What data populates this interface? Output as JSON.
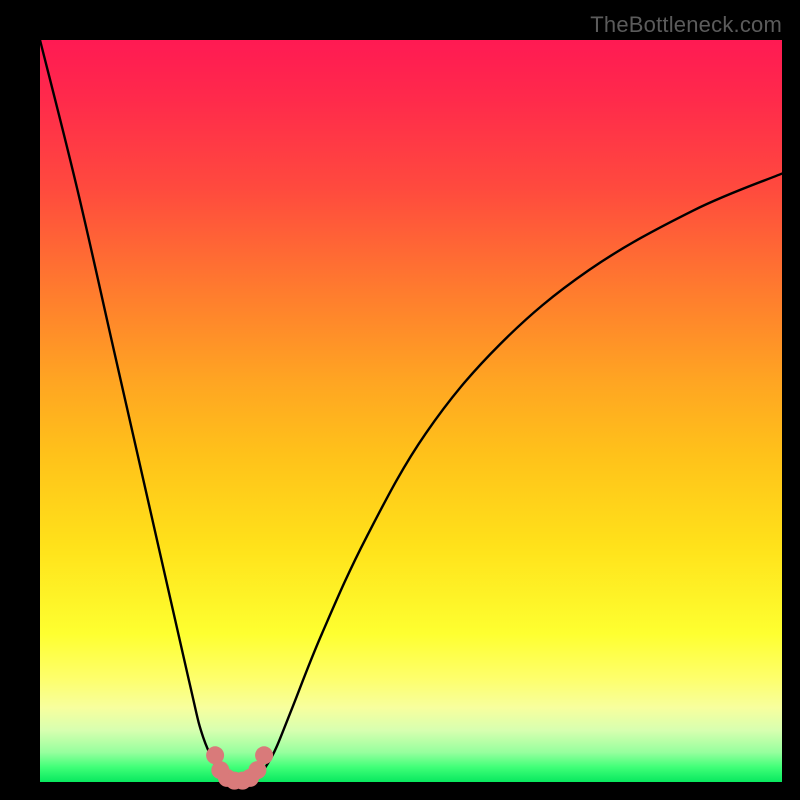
{
  "watermark": {
    "text": "TheBottleneck.com"
  },
  "chart_data": {
    "type": "line",
    "title": "",
    "xlabel": "",
    "ylabel": "",
    "xlim": [
      0,
      100
    ],
    "ylim": [
      0,
      100
    ],
    "grid": false,
    "series": [
      {
        "name": "bottleneck-curve",
        "x": [
          0,
          5,
          10,
          15,
          20,
          22,
          24.5,
          25,
          26,
          27,
          28,
          29,
          30,
          31,
          32,
          34,
          38,
          44,
          52,
          62,
          74,
          88,
          100
        ],
        "y": [
          100,
          80,
          58,
          36,
          14,
          6,
          0.6,
          0.2,
          0,
          0,
          0.2,
          0.6,
          1.5,
          3,
          5,
          10,
          20,
          33,
          47,
          59,
          69,
          77,
          82
        ]
      }
    ],
    "markers": {
      "name": "trough-markers",
      "color": "#d97a7a",
      "points": [
        {
          "x": 23.6,
          "y": 3.6
        },
        {
          "x": 24.3,
          "y": 1.6
        },
        {
          "x": 25.2,
          "y": 0.55
        },
        {
          "x": 26.2,
          "y": 0.18
        },
        {
          "x": 27.3,
          "y": 0.18
        },
        {
          "x": 28.3,
          "y": 0.55
        },
        {
          "x": 29.3,
          "y": 1.6
        },
        {
          "x": 30.2,
          "y": 3.6
        }
      ]
    }
  }
}
